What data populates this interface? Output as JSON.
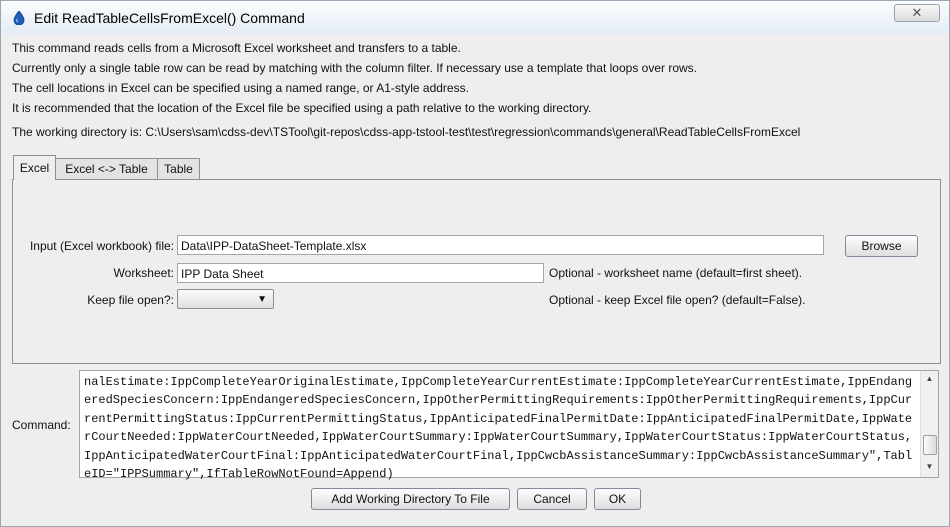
{
  "window": {
    "title": "Edit ReadTableCellsFromExcel() Command",
    "close_glyph": "✕",
    "icon": "droplet-icon",
    "icon_color": "#1f5fbf"
  },
  "info": {
    "line1": "This command reads cells from a Microsoft Excel worksheet and transfers to a table.",
    "line2": "Currently only a single table row can be read by matching with the column filter.  If necessary use a template that loops over rows.",
    "line3": "The cell locations in Excel can be specified using a named range, or A1-style address.",
    "line4": "It is recommended that the location of the Excel file be specified using a path relative to the working directory.",
    "working_dir": "The working directory is: C:\\Users\\sam\\cdss-dev\\TSTool\\git-repos\\cdss-app-tstool-test\\test\\regression\\commands\\general\\ReadTableCellsFromExcel"
  },
  "tabs": [
    {
      "label": "Excel",
      "active": true
    },
    {
      "label": "Excel <-> Table",
      "active": false
    },
    {
      "label": "Table",
      "active": false
    }
  ],
  "excel": {
    "input_label": "Input (Excel workbook) file:",
    "input_value": "Data\\IPP-DataSheet-Template.xlsx",
    "browse_label": "Browse",
    "worksheet_label": "Worksheet:",
    "worksheet_value": "IPP Data Sheet",
    "worksheet_hint": "Optional - worksheet name (default=first sheet).",
    "keep_open_label": "Keep file open?:",
    "keep_open_value": "",
    "keep_open_hint": "Optional - keep Excel file open? (default=False)."
  },
  "command": {
    "label": "Command:",
    "text": "nalEstimate:IppCompleteYearOriginalEstimate,IppCompleteYearCurrentEstimate:IppCompleteYearCurrentEstimate,IppEndangeredSpeciesConcern:IppEndangeredSpeciesConcern,IppOtherPermittingRequirements:IppOtherPermittingRequirements,IppCurrentPermittingStatus:IppCurrentPermittingStatus,IppAnticipatedFinalPermitDate:IppAnticipatedFinalPermitDate,IppWaterCourtNeeded:IppWaterCourtNeeded,IppWaterCourtSummary:IppWaterCourtSummary,IppWaterCourtStatus:IppWaterCourtStatus,IppAnticipatedWaterCourtFinal:IppAnticipatedWaterCourtFinal,IppCwcbAssistanceSummary:IppCwcbAssistanceSummary\",TableID=\"IPPSummary\",IfTableRowNotFound=Append)"
  },
  "buttons": {
    "add_wd": "Add Working Directory To File",
    "cancel": "Cancel",
    "ok": "OK"
  }
}
